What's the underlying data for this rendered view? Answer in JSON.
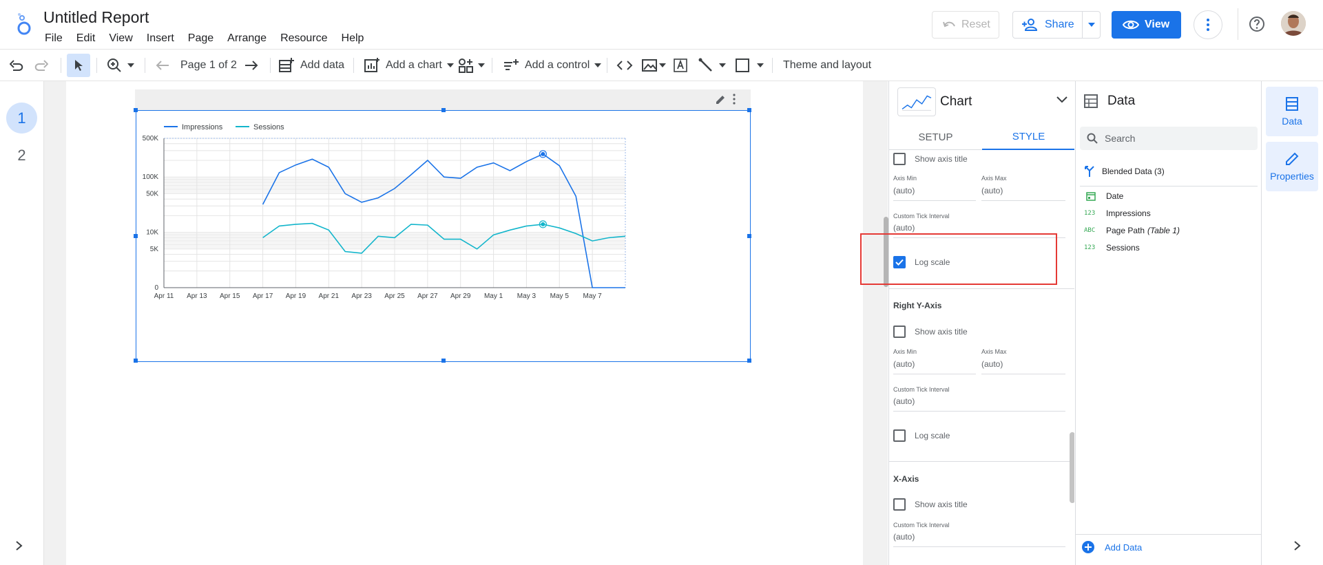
{
  "app": {
    "title": "Untitled Report",
    "menu": [
      "File",
      "Edit",
      "View",
      "Insert",
      "Page",
      "Arrange",
      "Resource",
      "Help"
    ],
    "reset_label": "Reset",
    "share_label": "Share",
    "view_label": "View"
  },
  "toolbar": {
    "page_indicator": "Page 1 of 2",
    "add_data": "Add data",
    "add_chart": "Add a chart",
    "add_control": "Add a control",
    "theme": "Theme and layout"
  },
  "pages": [
    "1",
    "2"
  ],
  "properties": {
    "chart_type": "Chart",
    "tabs": [
      "SETUP",
      "STYLE"
    ],
    "active_tab": "STYLE",
    "left_axis": {
      "show_axis_title": "Show axis title",
      "axis_min_label": "Axis Min",
      "axis_max_label": "Axis Max",
      "axis_min": "(auto)",
      "axis_max": "(auto)",
      "tick_label": "Custom Tick Interval",
      "tick": "(auto)",
      "log_scale": "Log scale",
      "log_scale_checked": true
    },
    "right_axis": {
      "title": "Right Y-Axis",
      "show_axis_title": "Show axis title",
      "axis_min_label": "Axis Min",
      "axis_max_label": "Axis Max",
      "axis_min": "(auto)",
      "axis_max": "(auto)",
      "tick_label": "Custom Tick Interval",
      "tick": "(auto)",
      "log_scale": "Log scale",
      "log_scale_checked": false
    },
    "x_axis": {
      "title": "X-Axis",
      "show_axis_title": "Show axis title",
      "tick_label": "Custom Tick Interval",
      "tick": "(auto)"
    }
  },
  "data_panel": {
    "title": "Data",
    "search_placeholder": "Search",
    "data_source": "Blended Data (3)",
    "fields": [
      {
        "type": "date",
        "name": "Date",
        "table": ""
      },
      {
        "type": "123",
        "name": "Impressions",
        "table": ""
      },
      {
        "type": "ABC",
        "name": "Page Path",
        "table": "(Table 1)"
      },
      {
        "type": "123",
        "name": "Sessions",
        "table": ""
      }
    ],
    "add_data": "Add Data"
  },
  "right_rail": {
    "data_tab": "Data",
    "properties_tab": "Properties"
  },
  "chart_data": {
    "type": "line",
    "log_scale": true,
    "y_ticks": [
      "500K",
      "100K",
      "50K",
      "10K",
      "5K",
      "0"
    ],
    "x_labels": [
      "Apr 11",
      "Apr 13",
      "Apr 15",
      "Apr 17",
      "Apr 19",
      "Apr 21",
      "Apr 23",
      "Apr 25",
      "Apr 27",
      "Apr 29",
      "May 1",
      "May 3",
      "May 5",
      "May 7"
    ],
    "x": [
      "Apr 17",
      "Apr 18",
      "Apr 19",
      "Apr 20",
      "Apr 21",
      "Apr 22",
      "Apr 23",
      "Apr 24",
      "Apr 25",
      "Apr 26",
      "Apr 27",
      "Apr 28",
      "Apr 29",
      "Apr 30",
      "May 1",
      "May 2",
      "May 3",
      "May 4",
      "May 5",
      "May 6",
      "May 7",
      "May 8",
      "May 9"
    ],
    "series": [
      {
        "name": "Impressions",
        "color": "#1a73e8",
        "values": [
          32000,
          120000,
          165000,
          210000,
          150000,
          50000,
          35000,
          42000,
          62000,
          110000,
          200000,
          100000,
          95000,
          150000,
          180000,
          130000,
          190000,
          260000,
          160000,
          45000,
          0,
          0,
          0
        ]
      },
      {
        "name": "Sessions",
        "color": "#12b5cb",
        "values": [
          8000,
          13000,
          14000,
          14500,
          11000,
          4500,
          4200,
          8500,
          8000,
          14000,
          13500,
          7500,
          7500,
          5000,
          9000,
          11000,
          13000,
          14000,
          12000,
          9500,
          7000,
          8000,
          8500
        ]
      }
    ]
  }
}
